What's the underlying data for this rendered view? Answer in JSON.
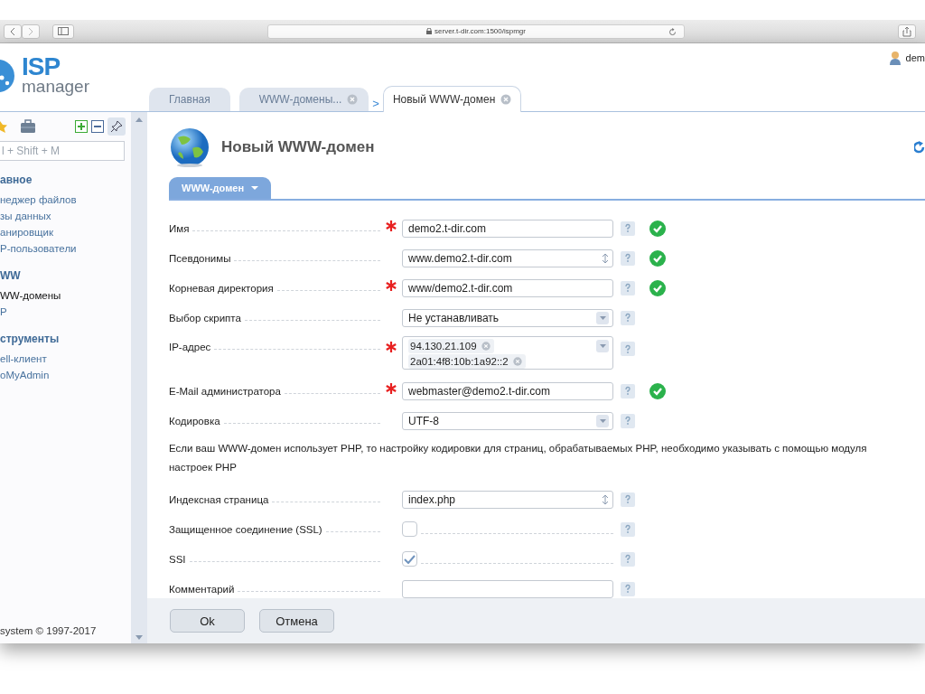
{
  "browser": {
    "address": "server.t-dir.com:1500/ispmgr"
  },
  "header": {
    "logo_top": "ISP",
    "logo_bottom": "manager",
    "user": "dem"
  },
  "tabs": [
    {
      "kind": "tab",
      "label": "Главная",
      "selected": false,
      "closable": false
    },
    {
      "kind": "tab",
      "label": "WWW-домены...",
      "selected": false,
      "closable": true
    },
    {
      "kind": "separator",
      "label": ">"
    },
    {
      "kind": "tab",
      "label": "Новый WWW-домен",
      "selected": true,
      "closable": true
    }
  ],
  "sidebar": {
    "search": {
      "placeholder": "l + Shift + M"
    },
    "groups": [
      {
        "title": "авное",
        "items": [
          {
            "label": "неджер файлов",
            "selected": false
          },
          {
            "label": "зы данных",
            "selected": false
          },
          {
            "label": "анировщик",
            "selected": false
          },
          {
            "label": "P-пользователи",
            "selected": false
          }
        ]
      },
      {
        "title": "WW",
        "items": [
          {
            "label": "WW-домены",
            "selected": true
          },
          {
            "label": "P",
            "selected": false
          }
        ]
      },
      {
        "title": "струменты",
        "items": [
          {
            "label": "ell-клиент",
            "selected": false
          },
          {
            "label": "oMyAdmin",
            "selected": false
          }
        ]
      }
    ],
    "footer": "system © 1997-2017"
  },
  "page": {
    "title": "Новый WWW-домен",
    "form_tab": "WWW-домен"
  },
  "fields": [
    {
      "kind": "text",
      "label": "Имя",
      "required": true,
      "value": "demo2.t-dir.com",
      "valid": true
    },
    {
      "kind": "spinner",
      "label": "Псевдонимы",
      "required": false,
      "value": "www.demo2.t-dir.com",
      "valid": true
    },
    {
      "kind": "text",
      "label": "Корневая директория",
      "required": true,
      "value": "www/demo2.t-dir.com",
      "valid": true
    },
    {
      "kind": "select",
      "label": "Выбор скрипта",
      "required": false,
      "value": "Не устанавливать",
      "valid": false
    },
    {
      "kind": "multiselect",
      "label": "IP-адрес",
      "required": true,
      "values": [
        "94.130.21.109",
        "2a01:4f8:10b:1a92::2"
      ],
      "valid": false
    },
    {
      "kind": "text",
      "label": "E-Mail администратора",
      "required": true,
      "value": "webmaster@demo2.t-dir.com",
      "valid": true
    },
    {
      "kind": "select",
      "label": "Кодировка",
      "required": false,
      "value": "UTF-8",
      "valid": false
    },
    {
      "kind": "note",
      "text": "Если ваш WWW-домен использует PHP, то настройку кодировки для страниц, обрабатываемых PHP, необходимо указывать с помощью модуля настроек PHP"
    },
    {
      "kind": "spinner",
      "label": "Индексная страница",
      "required": false,
      "value": "index.php",
      "valid": false
    },
    {
      "kind": "checkbox",
      "label": "Защищенное соединение (SSL)",
      "checked": false
    },
    {
      "kind": "checkbox",
      "label": "SSI",
      "checked": true
    },
    {
      "kind": "text",
      "label": "Комментарий",
      "required": false,
      "valid": false
    }
  ],
  "buttons": [
    "Ok",
    "Отмена"
  ]
}
